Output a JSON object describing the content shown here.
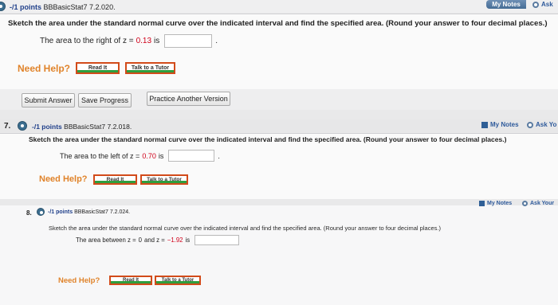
{
  "q6": {
    "points": "-/1 points",
    "source": "BBBasicStat7 7.2.020.",
    "my_notes": "My Notes",
    "ask": "Ask",
    "prompt": "Sketch the area under the standard normal curve over the indicated interval and find the specified area. (Round your answer to four decimal places.)",
    "answer_prefix": "The area to the right of z =",
    "z_value": "0.13",
    "answer_suffix": "is",
    "answer_value": "",
    "period": ".",
    "need_help": "Need Help?",
    "read_it": "Read It",
    "talk_to_tutor": "Talk to a Tutor",
    "submit_answer": "Submit Answer",
    "save_progress": "Save Progress",
    "practice_another": "Practice Another Version"
  },
  "q7": {
    "number": "7.",
    "points": "-/1 points",
    "source": "BBBasicStat7 7.2.018.",
    "my_notes": "My Notes",
    "ask": "Ask Yo",
    "prompt": "Sketch the area under the standard normal curve over the indicated interval and find the specified area. (Round your answer to four decimal places.)",
    "answer_prefix": "The area to the left of z =",
    "z_value": "0.70",
    "answer_suffix": "is",
    "answer_value": "",
    "period": ".",
    "need_help": "Need Help?",
    "read_it": "Read It",
    "talk_to_tutor": "Talk to a Tutor"
  },
  "q8": {
    "number": "8.",
    "points": "-/1 points",
    "source": "BBBasicStat7 7.2.024.",
    "my_notes": "My Notes",
    "ask": "Ask Your",
    "prompt": "Sketch the area under the standard normal curve over the indicated interval and find the specified area. (Round your answer to four decimal places.)",
    "answer_prefix": "The area between z =",
    "z_low": "0",
    "and_text": "and z =",
    "z_value": "−1.92",
    "answer_suffix": "is",
    "answer_value": "",
    "need_help": "Need Help?",
    "read_it": "Read It",
    "talk_to_tutor": "Talk to a Tutor"
  },
  "colors": {
    "points_blue": "#1f3f8a",
    "z_value_red": "#d0021b",
    "need_help_orange": "#e0832a",
    "help_button_border": "#d24b1a"
  },
  "icons": [
    "radio-circle-icon",
    "my-notes-icon",
    "ask-your-teacher-icon"
  ]
}
